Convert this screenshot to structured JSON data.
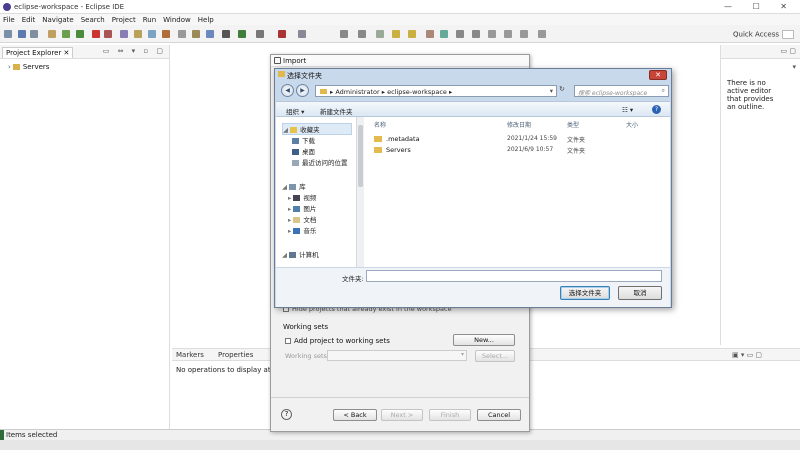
{
  "window": {
    "title": "eclipse-workspace - Eclipse IDE",
    "controls": "— ☐ ✕"
  },
  "menu": [
    "File",
    "Edit",
    "Navigate",
    "Search",
    "Project",
    "Run",
    "Window",
    "Help"
  ],
  "quick_access": "Quick Access",
  "project_explorer": {
    "tab": "Project Explorer ✕",
    "tree_item": "Servers"
  },
  "outline": {
    "message": "There is no active editor that provides an outline."
  },
  "bottom_panel": {
    "tab_markers": "Markers",
    "tab_properties": "Properties",
    "message": "No operations to display at this"
  },
  "status": {
    "text": "Items selected"
  },
  "import_wizard": {
    "title": "Import",
    "hidden_text": "Hide projects that already exist in the workspace",
    "working_sets_label": "Working sets",
    "add_to_working_sets": "Add project to working sets",
    "new_button": "New...",
    "working_sets_field_label": "Working sets:",
    "select_button": "Select...",
    "help_glyph": "?",
    "back_button": "< Back",
    "next_button": "Next >",
    "finish_button": "Finish",
    "cancel_button": "Cancel"
  },
  "folder_dialog": {
    "title": "选择文件夹",
    "close": "✕",
    "address": [
      "Administrator",
      "▸",
      "eclipse-workspace",
      "▸"
    ],
    "search_placeholder": "搜索 eclipse-workspace",
    "organize": "组织 ▾",
    "new_folder": "新建文件夹",
    "nav": {
      "favorites": "收藏夹",
      "downloads": "下载",
      "desktop": "桌面",
      "recent": "最近访问的位置",
      "libraries": "库",
      "videos": "视频",
      "pictures": "图片",
      "documents": "文档",
      "music": "音乐",
      "computer": "计算机"
    },
    "columns": {
      "name": "名称",
      "date": "修改日期",
      "type": "类型",
      "size": "大小"
    },
    "files": [
      {
        "name": ".metadata",
        "date": "2021/1/24 15:59",
        "type": "文件夹"
      },
      {
        "name": "Servers",
        "date": "2021/6/9 10:57",
        "type": "文件夹"
      }
    ],
    "folder_label": "文件夹:",
    "folder_value": "",
    "select_button": "选择文件夹",
    "cancel_button": "取消"
  }
}
